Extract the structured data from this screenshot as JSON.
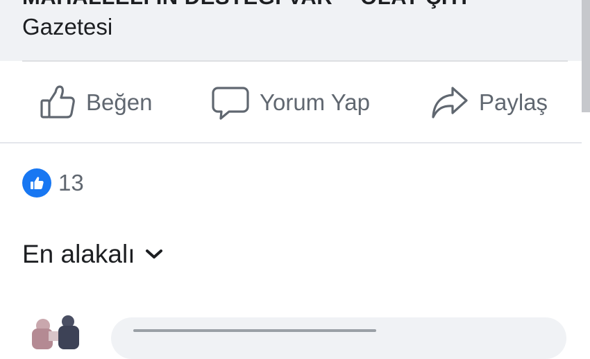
{
  "preview": {
    "title_fragment_left": "MAHALLELİ İN DESTEĞİ VAR",
    "title_fragment_right": "OLAY ÇİTİ",
    "source": "Gazetesi"
  },
  "actions": {
    "like_label": "Beğen",
    "comment_label": "Yorum Yap",
    "share_label": "Paylaş"
  },
  "reactions": {
    "icon": "thumbs-up-reaction-icon",
    "count": "13"
  },
  "sort": {
    "label": "En alakalı",
    "icon": "chevron-down-icon"
  },
  "colors": {
    "accent": "#1877f2",
    "muted_text": "#606770",
    "card_bg": "#f0f2f5"
  }
}
